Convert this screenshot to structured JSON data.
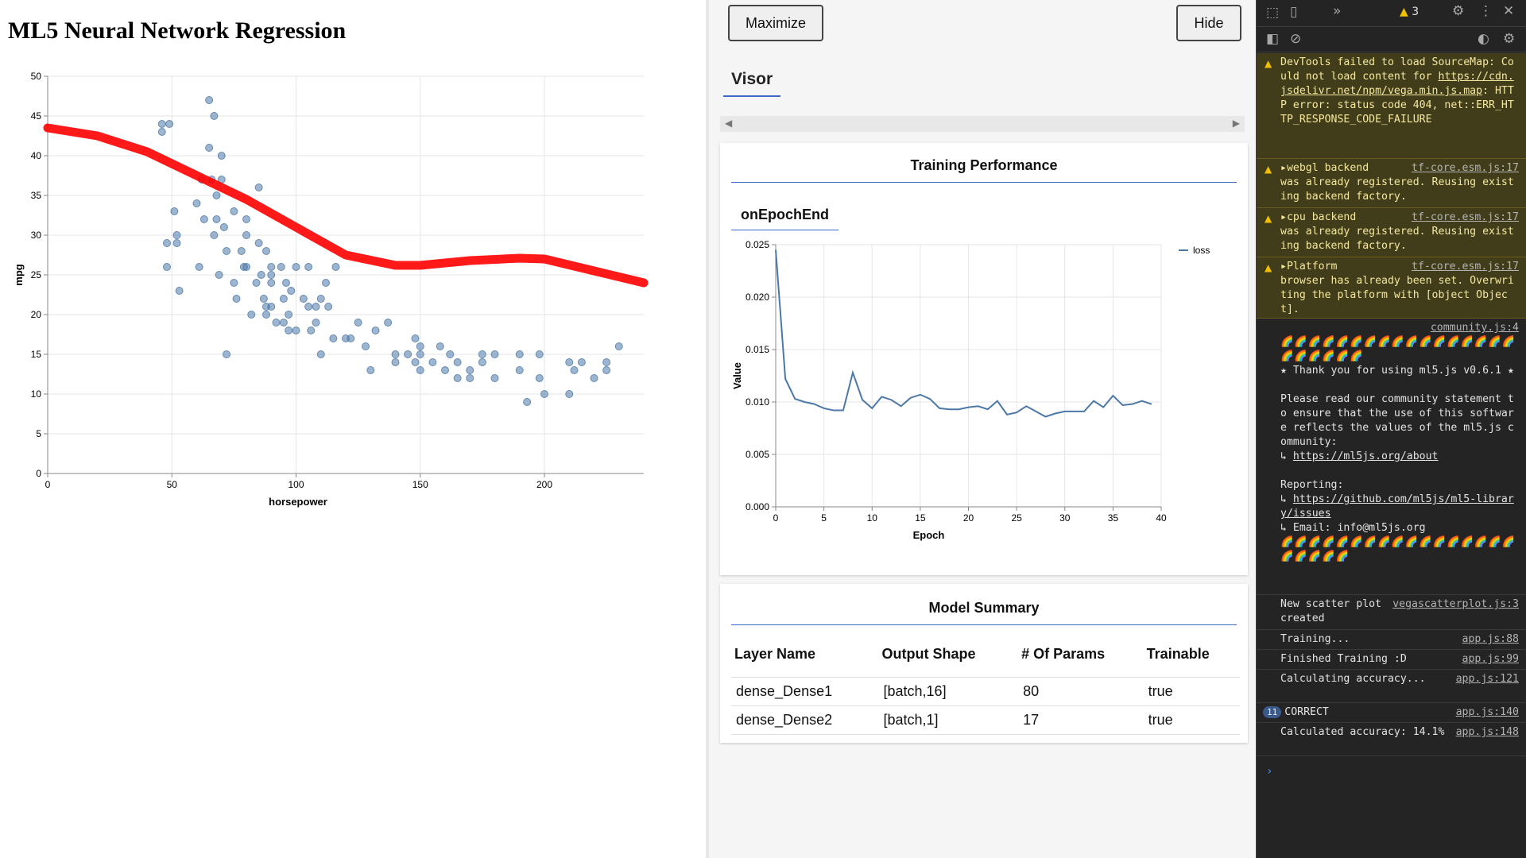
{
  "main": {
    "title": "ML5 Neural Network Regression",
    "scatter": {
      "xlabel": "horsepower",
      "ylabel": "mpg",
      "x_ticks": [
        "0",
        "50",
        "100",
        "150",
        "200"
      ],
      "y_ticks": [
        "0",
        "5",
        "10",
        "15",
        "20",
        "25",
        "30",
        "35",
        "40",
        "45",
        "50"
      ],
      "colors": {
        "points": "#4c78a8",
        "prediction": "#ff0000"
      }
    }
  },
  "chart_data": [
    {
      "type": "scatter",
      "title": "",
      "xlabel": "horsepower",
      "ylabel": "mpg",
      "xlim": [
        0,
        240
      ],
      "ylim": [
        0,
        50
      ],
      "grid": true,
      "series": [
        {
          "points": [
            [
              46,
              44
            ],
            [
              46,
              43
            ],
            [
              48,
              29
            ],
            [
              48,
              26
            ],
            [
              49,
              44
            ],
            [
              51,
              33
            ],
            [
              52,
              29
            ],
            [
              52,
              30
            ],
            [
              53,
              23
            ],
            [
              60,
              34
            ],
            [
              61,
              26
            ],
            [
              62,
              37
            ],
            [
              63,
              32
            ],
            [
              65,
              47
            ],
            [
              65,
              41
            ],
            [
              66,
              37
            ],
            [
              67,
              30
            ],
            [
              67,
              45
            ],
            [
              68,
              35
            ],
            [
              68,
              32
            ],
            [
              69,
              25
            ],
            [
              70,
              37
            ],
            [
              70,
              40
            ],
            [
              71,
              31
            ],
            [
              72,
              15
            ],
            [
              72,
              28
            ],
            [
              75,
              33
            ],
            [
              75,
              24
            ],
            [
              76,
              22
            ],
            [
              78,
              28
            ],
            [
              79,
              26
            ],
            [
              80,
              30
            ],
            [
              80,
              32
            ],
            [
              80,
              26
            ],
            [
              82,
              20
            ],
            [
              84,
              24
            ],
            [
              85,
              29
            ],
            [
              85,
              36
            ],
            [
              86,
              25
            ],
            [
              87,
              22
            ],
            [
              88,
              21
            ],
            [
              88,
              28
            ],
            [
              88,
              20
            ],
            [
              90,
              24
            ],
            [
              90,
              26
            ],
            [
              90,
              25
            ],
            [
              90,
              21
            ],
            [
              92,
              19
            ],
            [
              94,
              26
            ],
            [
              95,
              19
            ],
            [
              95,
              22
            ],
            [
              96,
              24
            ],
            [
              97,
              20
            ],
            [
              97,
              18
            ],
            [
              98,
              23
            ],
            [
              100,
              26
            ],
            [
              100,
              18
            ],
            [
              103,
              22
            ],
            [
              105,
              26
            ],
            [
              105,
              21
            ],
            [
              106,
              18
            ],
            [
              108,
              19
            ],
            [
              108,
              21
            ],
            [
              110,
              15
            ],
            [
              110,
              22
            ],
            [
              112,
              24
            ],
            [
              113,
              21
            ],
            [
              115,
              17
            ],
            [
              116,
              26
            ],
            [
              120,
              17
            ],
            [
              122,
              17
            ],
            [
              125,
              19
            ],
            [
              128,
              16
            ],
            [
              130,
              13
            ],
            [
              132,
              18
            ],
            [
              137,
              19
            ],
            [
              140,
              15
            ],
            [
              140,
              14
            ],
            [
              145,
              15
            ],
            [
              148,
              14
            ],
            [
              148,
              17
            ],
            [
              150,
              16
            ],
            [
              150,
              15
            ],
            [
              150,
              13
            ],
            [
              155,
              14
            ],
            [
              158,
              16
            ],
            [
              160,
              13
            ],
            [
              162,
              15
            ],
            [
              165,
              12
            ],
            [
              165,
              14
            ],
            [
              170,
              13
            ],
            [
              170,
              12
            ],
            [
              175,
              14
            ],
            [
              175,
              15
            ],
            [
              180,
              15
            ],
            [
              180,
              12
            ],
            [
              190,
              15
            ],
            [
              190,
              13
            ],
            [
              193,
              9
            ],
            [
              198,
              15
            ],
            [
              198,
              12
            ],
            [
              200,
              10
            ],
            [
              210,
              14
            ],
            [
              210,
              10
            ],
            [
              212,
              13
            ],
            [
              215,
              14
            ],
            [
              220,
              12
            ],
            [
              225,
              13
            ],
            [
              225,
              14
            ],
            [
              230,
              16
            ]
          ]
        },
        {
          "name": "prediction",
          "type": "line",
          "points": [
            [
              0,
              43.5
            ],
            [
              20,
              42.5
            ],
            [
              40,
              40.5
            ],
            [
              60,
              37.5
            ],
            [
              80,
              34.5
            ],
            [
              100,
              31
            ],
            [
              120,
              27.5
            ],
            [
              140,
              26.2
            ],
            [
              150,
              26.2
            ],
            [
              170,
              26.8
            ],
            [
              190,
              27.1
            ],
            [
              200,
              27
            ],
            [
              220,
              25.5
            ],
            [
              240,
              24
            ]
          ]
        }
      ]
    },
    {
      "type": "line",
      "title": "",
      "xlabel": "Epoch",
      "ylabel": "Value",
      "xlim": [
        0,
        40
      ],
      "ylim": [
        0,
        0.025
      ],
      "grid": true,
      "legend": "top-right",
      "series": [
        {
          "name": "loss",
          "x": [
            0,
            1,
            2,
            3,
            4,
            5,
            6,
            7,
            8,
            9,
            10,
            11,
            12,
            13,
            14,
            15,
            16,
            17,
            18,
            19,
            20,
            21,
            22,
            23,
            24,
            25,
            26,
            27,
            28,
            29,
            30,
            31,
            32,
            33,
            34,
            35,
            36,
            37,
            38,
            39
          ],
          "values": [
            0.0245,
            0.0122,
            0.0103,
            0.01,
            0.0098,
            0.0094,
            0.0092,
            0.0092,
            0.0128,
            0.0102,
            0.0094,
            0.0105,
            0.0102,
            0.0096,
            0.0104,
            0.0107,
            0.0103,
            0.0094,
            0.0093,
            0.0093,
            0.0095,
            0.0096,
            0.0093,
            0.0101,
            0.0088,
            0.009,
            0.0096,
            0.0091,
            0.0086,
            0.0089,
            0.0091,
            0.0091,
            0.0091,
            0.0101,
            0.0095,
            0.0106,
            0.0097,
            0.0098,
            0.0101,
            0.0098
          ]
        }
      ]
    }
  ],
  "visor": {
    "maximize_label": "Maximize",
    "hide_label": "Hide",
    "tab_label": "Visor",
    "perf_title": "Training Performance",
    "subtab_label": "onEpochEnd",
    "loss_chart": {
      "ylabel": "Value",
      "xlabel": "Epoch",
      "legend_label": "loss",
      "y_ticks": [
        "0.000",
        "0.005",
        "0.010",
        "0.015",
        "0.020",
        "0.025"
      ],
      "x_ticks": [
        "0",
        "5",
        "10",
        "15",
        "20",
        "25",
        "30",
        "35",
        "40"
      ],
      "line_color": "#4c78a8"
    },
    "model_title": "Model Summary",
    "columns": [
      "Layer Name",
      "Output Shape",
      "# Of Params",
      "Trainable"
    ],
    "rows": [
      [
        "dense_Dense1",
        "[batch,16]",
        "80",
        "true"
      ],
      [
        "dense_Dense2",
        "[batch,1]",
        "17",
        "true"
      ]
    ]
  },
  "devtools": {
    "warning_count": "3",
    "context": "top",
    "messages": {
      "sourcemap": "DevTools failed to load SourceMap: Could not load content for ",
      "sourcemap_url": "https://cdn.jsdelivr.net/npm/vega.min.js.map",
      "sourcemap_tail": ": HTTP error: status code 404, net::ERR_HTTP_RESPONSE_CODE_FAILURE",
      "webgl": "webgl backend",
      "webgl_tail": "was already registered. Reusing existing backend factory.",
      "cpu": "cpu backend",
      "cpu_tail": "was already registered. Reusing existing backend factory.",
      "platform": "Platform",
      "platform_tail": "browser has already been set. Overwriting the platform with [object Object].",
      "tfcore_src": "tf-core.esm.js:17",
      "community_src": "community.js:4",
      "rainbow1": "🌈🌈🌈🌈🌈🌈🌈🌈🌈🌈🌈🌈🌈🌈🌈🌈🌈🌈🌈🌈🌈🌈🌈",
      "thanks": "★ Thank you for using ml5.js v0.6.1 ★",
      "community_text": "Please read our community statement to ensure that the use of this software reflects the values of the ml5.js community:",
      "about_link": "https://ml5js.org/about",
      "reporting": "Reporting:",
      "issues_link": "https://github.com/ml5js/ml5-library/issues",
      "email": "Email: info@ml5js.org",
      "rainbow2": "🌈🌈🌈🌈🌈🌈🌈🌈🌈🌈🌈🌈🌈🌈🌈🌈🌈🌈🌈🌈🌈🌈",
      "scatter_created": "New scatter plot created",
      "scatter_src": "vegascatterplot.js:3",
      "training": "Training...",
      "training_src": "app.js:88",
      "finished": "Finished Training :D",
      "finished_src": "app.js:99",
      "calculating": "Calculating accuracy...",
      "calculating_src": "app.js:121",
      "correct_count": "11",
      "correct": "CORRECT",
      "correct_src": "app.js:140",
      "calculated": "Calculated accuracy: 14.1%",
      "calculated_src": "app.js:148"
    }
  }
}
